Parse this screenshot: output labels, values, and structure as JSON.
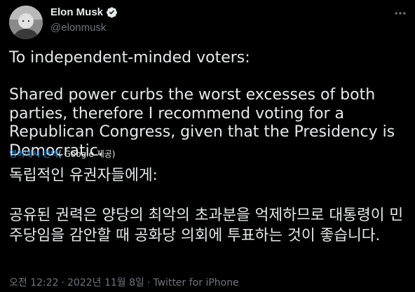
{
  "author": {
    "name": "Elon Musk",
    "handle": "@elonmusk",
    "verified": true
  },
  "tweet": {
    "text_en": "To independent-minded voters:\n\nShared power curbs the worst excesses of both parties, therefore I recommend voting for a Republican Congress, given that the Presidency is Democratic.",
    "translate_label": "영어에서 번역",
    "translate_source": "( Google 제공)",
    "text_ko": "독립적인 유권자들에게:\n\n공유된 권력은 양당의 최악의 초과분을 억제하므로 대통령이 민주당임을 감안할 때 공화당 의회에 투표하는 것이 좋습니다.",
    "time": "오전 12:22",
    "date": "2022년 11월 8일",
    "source": "Twitter for iPhone",
    "separator": "·"
  },
  "colors": {
    "background": "#000000",
    "text": "#e7e9ea",
    "muted": "#71767b",
    "accent": "#1d9bf0"
  },
  "icons": {
    "verified": "verified-badge-icon",
    "more": "more-options-icon"
  }
}
